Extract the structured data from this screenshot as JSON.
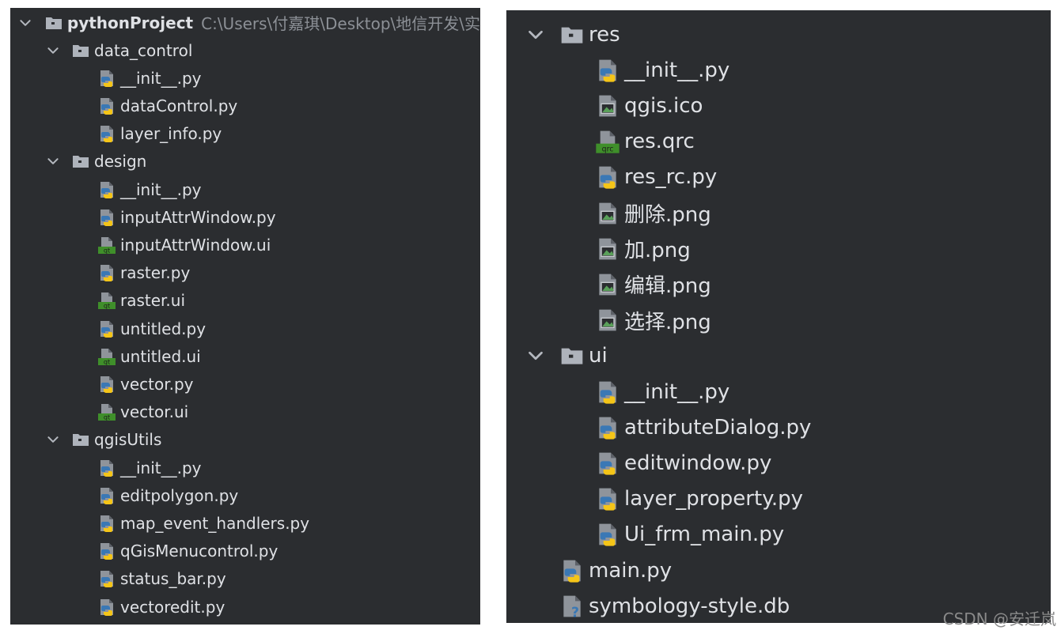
{
  "left_tree": {
    "root": {
      "name": "pythonProject",
      "path": "C:\\Users\\付嘉琪\\Desktop\\地信开发\\实"
    },
    "rows": [
      {
        "kind": "folder",
        "label": "data_control",
        "depth": 1,
        "expanded": true
      },
      {
        "kind": "python",
        "label": "__init__.py",
        "depth": 2
      },
      {
        "kind": "python",
        "label": "dataControl.py",
        "depth": 2
      },
      {
        "kind": "python",
        "label": "layer_info.py",
        "depth": 2
      },
      {
        "kind": "folder",
        "label": "design",
        "depth": 1,
        "expanded": true
      },
      {
        "kind": "python",
        "label": "__init__.py",
        "depth": 2
      },
      {
        "kind": "python",
        "label": "inputAttrWindow.py",
        "depth": 2
      },
      {
        "kind": "qt",
        "label": "inputAttrWindow.ui",
        "depth": 2
      },
      {
        "kind": "python",
        "label": "raster.py",
        "depth": 2
      },
      {
        "kind": "qt",
        "label": "raster.ui",
        "depth": 2
      },
      {
        "kind": "python",
        "label": "untitled.py",
        "depth": 2
      },
      {
        "kind": "qt",
        "label": "untitled.ui",
        "depth": 2
      },
      {
        "kind": "python",
        "label": "vector.py",
        "depth": 2
      },
      {
        "kind": "qt",
        "label": "vector.ui",
        "depth": 2
      },
      {
        "kind": "folder",
        "label": "qgisUtils",
        "depth": 1,
        "expanded": true
      },
      {
        "kind": "python",
        "label": "__init__.py",
        "depth": 2
      },
      {
        "kind": "python",
        "label": "editpolygon.py",
        "depth": 2
      },
      {
        "kind": "python",
        "label": "map_event_handlers.py",
        "depth": 2
      },
      {
        "kind": "python",
        "label": "qGisMenucontrol.py",
        "depth": 2
      },
      {
        "kind": "python",
        "label": "status_bar.py",
        "depth": 2
      },
      {
        "kind": "python",
        "label": "vectoredit.py",
        "depth": 2
      }
    ]
  },
  "right_tree": {
    "rows": [
      {
        "kind": "folder",
        "label": "res",
        "depth": 1,
        "expanded": true
      },
      {
        "kind": "python",
        "label": "__init__.py",
        "depth": 2
      },
      {
        "kind": "image",
        "label": "qgis.ico",
        "depth": 2
      },
      {
        "kind": "qrc",
        "label": "res.qrc",
        "depth": 2
      },
      {
        "kind": "python",
        "label": "res_rc.py",
        "depth": 2
      },
      {
        "kind": "image",
        "label": "删除.png",
        "depth": 2
      },
      {
        "kind": "image",
        "label": "加.png",
        "depth": 2
      },
      {
        "kind": "image",
        "label": "编辑.png",
        "depth": 2
      },
      {
        "kind": "image",
        "label": "选择.png",
        "depth": 2
      },
      {
        "kind": "folder",
        "label": "ui",
        "depth": 1,
        "expanded": true
      },
      {
        "kind": "python",
        "label": "__init__.py",
        "depth": 2
      },
      {
        "kind": "python",
        "label": "attributeDialog.py",
        "depth": 2
      },
      {
        "kind": "python",
        "label": "editwindow.py",
        "depth": 2
      },
      {
        "kind": "python",
        "label": "layer_property.py",
        "depth": 2
      },
      {
        "kind": "python",
        "label": "Ui_frm_main.py",
        "depth": 2
      },
      {
        "kind": "python",
        "label": "main.py",
        "depth": 1
      },
      {
        "kind": "unknown",
        "label": "symbology-style.db",
        "depth": 1
      }
    ]
  },
  "watermark": "CSDN @安迁岚",
  "icons": {
    "folder": "folder-icon",
    "python": "python-file-icon",
    "qt": "qt-ui-file-icon",
    "qrc": "qrc-file-icon",
    "image": "image-file-icon",
    "unknown": "unknown-file-icon",
    "chevron": "chevron-down-icon"
  },
  "colors": {
    "panel_bg": "#2b2d30",
    "text": "#dfe1e5",
    "path_text": "#8c9096",
    "folder": "#aeb3bb",
    "python_blue": "#3a78b5",
    "python_yellow": "#f5c518",
    "qt_green": "#3f8f2a",
    "image_green": "#5aa05a"
  }
}
